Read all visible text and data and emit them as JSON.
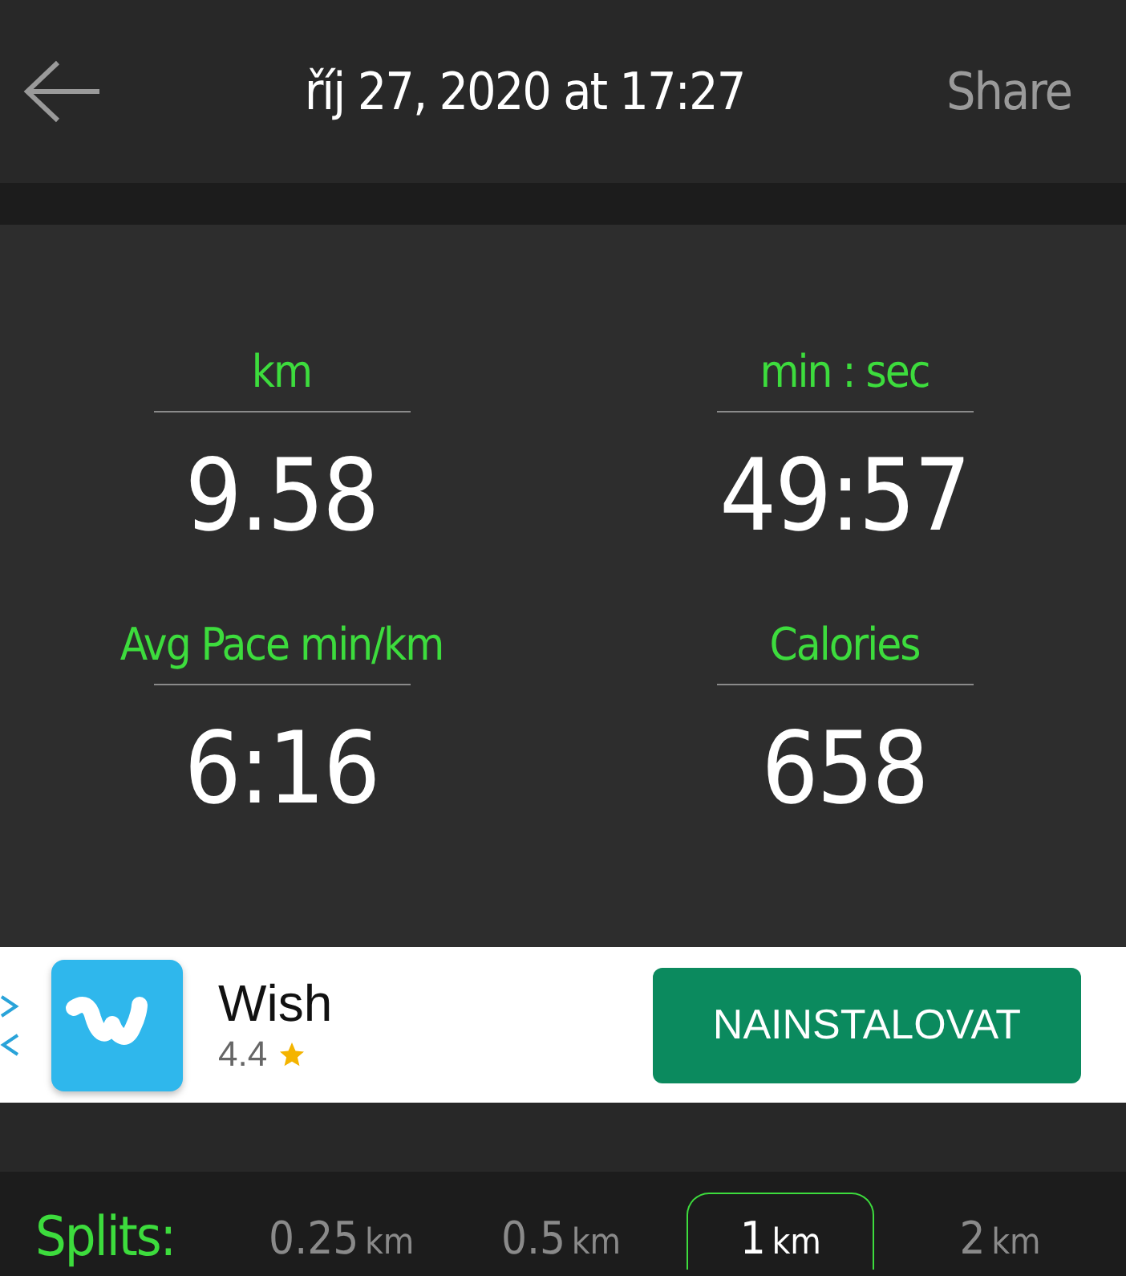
{
  "header": {
    "title": "říj 27, 2020 at 17:27",
    "action": "Share"
  },
  "stats": [
    {
      "label": "km",
      "value": "9.58"
    },
    {
      "label": "min : sec",
      "value": "49:57"
    },
    {
      "label": "Avg Pace min/km",
      "value": "6:16"
    },
    {
      "label": "Calories",
      "value": "658"
    }
  ],
  "ad": {
    "app_name": "Wish",
    "rating": "4.4",
    "button": "NAINSTALOVAT"
  },
  "splits": {
    "label": "Splits:",
    "options": [
      {
        "value": "0.25",
        "unit": "km",
        "selected": false
      },
      {
        "value": "0.5",
        "unit": "km",
        "selected": false
      },
      {
        "value": "1",
        "unit": "km",
        "selected": true
      },
      {
        "value": "2",
        "unit": "km",
        "selected": false
      }
    ]
  }
}
